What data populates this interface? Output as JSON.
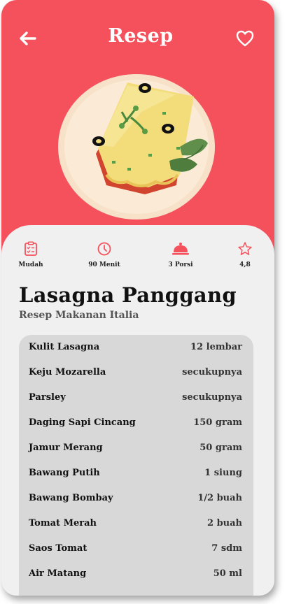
{
  "header": {
    "title": "Resep",
    "back_icon": "arrow-left-icon",
    "favorite_icon": "heart-outline-icon"
  },
  "theme": {
    "accent": "#f5515c",
    "panel": "#f0f0f0",
    "list_bg": "#d8d8d8"
  },
  "stats": [
    {
      "icon": "clipboard-checklist-icon",
      "label": "Mudah"
    },
    {
      "icon": "clock-icon",
      "label": "90 Menit"
    },
    {
      "icon": "serving-cloche-icon",
      "label": "3 Porsi"
    },
    {
      "icon": "star-outline-icon",
      "label": "4,8"
    }
  ],
  "recipe": {
    "name": "Lasagna Panggang",
    "subtitle": "Resep Makanan Italia"
  },
  "ingredients": [
    {
      "name": "Kulit Lasagna",
      "qty": "12 lembar"
    },
    {
      "name": "Keju Mozarella",
      "qty": "secukupnya"
    },
    {
      "name": "Parsley",
      "qty": "secukupnya"
    },
    {
      "name": "Daging Sapi Cincang",
      "qty": "150 gram"
    },
    {
      "name": "Jamur Merang",
      "qty": "50 gram"
    },
    {
      "name": "Bawang Putih",
      "qty": "1 siung"
    },
    {
      "name": "Bawang Bombay",
      "qty": "1/2 buah"
    },
    {
      "name": "Tomat Merah",
      "qty": "2 buah"
    },
    {
      "name": "Saos Tomat",
      "qty": "7 sdm"
    },
    {
      "name": "Air Matang",
      "qty": "50 ml"
    }
  ]
}
